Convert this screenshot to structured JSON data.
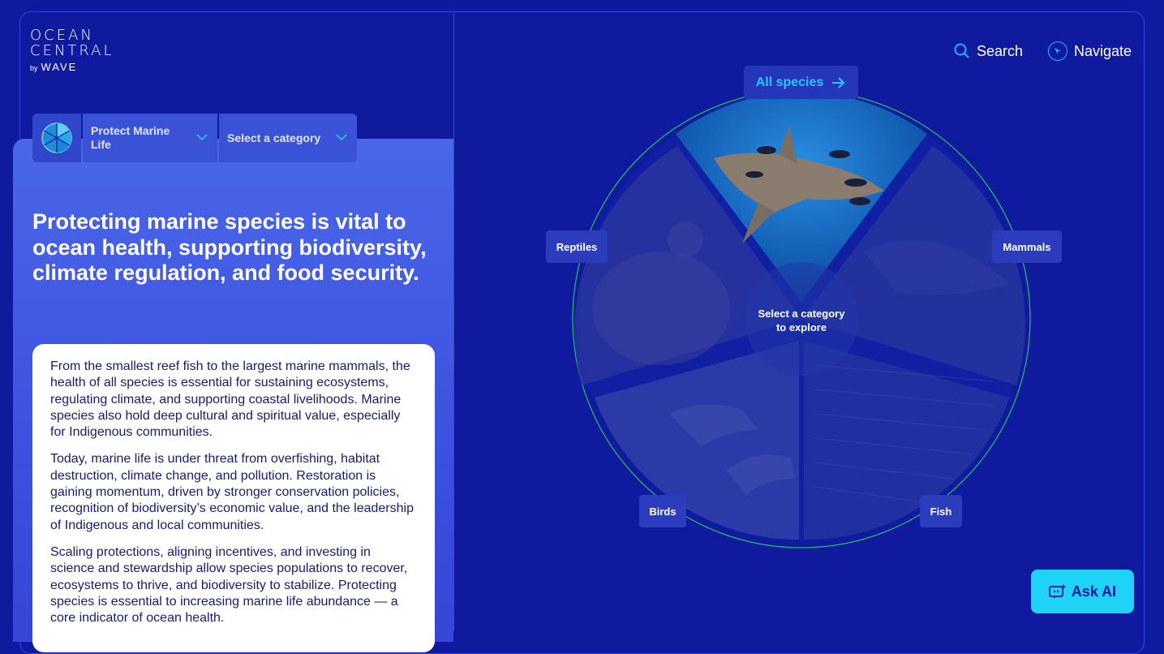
{
  "brand": {
    "line1": "OCEAN",
    "line2": "CENTRAL",
    "by": "by",
    "partner": "WAVE"
  },
  "selector": {
    "goal": "Protect Marine Life",
    "category_placeholder": "Select a category"
  },
  "headline": "Protecting marine species is vital to ocean health, supporting biodiversity, climate regulation, and food security.",
  "card": {
    "paragraphs": [
      "From the smallest reef fish to the largest marine mammals, the health of all species is essential for sustaining ecosystems, regulating climate, and supporting coastal livelihoods. Marine species also hold deep cultural and spiritual value, especially for Indigenous communities.",
      "Today, marine life is under threat from overfishing, habitat destruction, climate change, and pollution. Restoration is gaining momentum, driven by stronger conservation policies, recognition of biodiversity’s economic value, and the leadership of Indigenous and local communities.",
      "Scaling protections, aligning incentives, and investing in science and stewardship allow species populations to recover, ecosystems to thrive, and biodiversity to stabilize. Protecting species is essential to increasing marine life abundance — a core indicator of ocean health."
    ]
  },
  "topnav": {
    "search": "Search",
    "navigate": "Navigate"
  },
  "wheel": {
    "all_species": "All species",
    "center_line1": "Select a category",
    "center_line2": "to explore",
    "categories": [
      "Reptiles",
      "Mammals",
      "Birds",
      "Fish"
    ]
  },
  "ask_ai": "Ask AI",
  "colors": {
    "background": "#0f1a9e",
    "accent": "#1fd3f7",
    "panel": "#4a66e8",
    "ring": "#22c55e"
  }
}
